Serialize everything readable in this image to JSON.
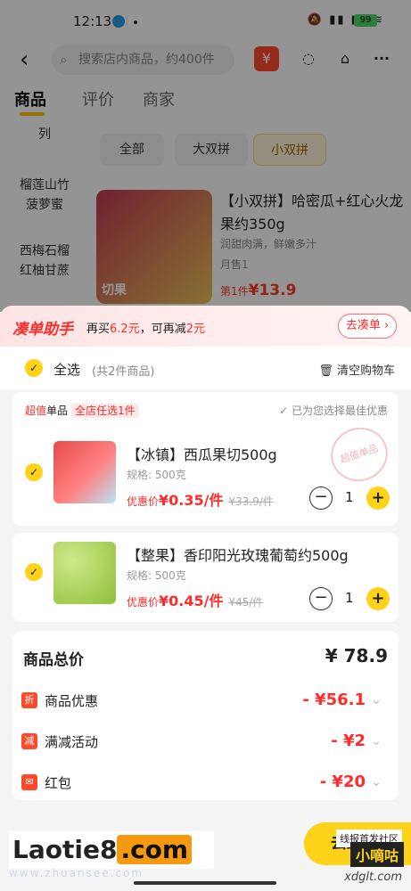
{
  "status": {
    "time": "12:13",
    "battery": "99"
  },
  "header": {
    "search_placeholder": "搜索店内商品，约400件"
  },
  "tabs": [
    {
      "label": "商品"
    },
    {
      "label": "评价"
    },
    {
      "label": "商家"
    }
  ],
  "sidebar": [
    "列",
    "榴莲山竹\n菠萝蜜",
    "西梅石榴\n红柚甘蔗"
  ],
  "filter_chips": [
    {
      "label": "全部"
    },
    {
      "label": "大双拼"
    },
    {
      "label": "小双拼"
    }
  ],
  "background_product": {
    "title": "【小双拼】哈密瓜+红心火龙果约350g",
    "subtitle": "润甜肉满，鲜嫩多汁",
    "sold": "月售1",
    "price_prefix": "第1件",
    "price": "¥13.9",
    "image_tag": "切果"
  },
  "cart": {
    "banner": {
      "logo": "凑单助手",
      "msg_prefix": "再买",
      "msg_amount": "6.2元",
      "msg_mid": "，可再减",
      "msg_discount": "2元",
      "go_label": "去凑单"
    },
    "select_all": "全选",
    "count": "(共2件商品)",
    "clear": "清空购物车",
    "promo": {
      "type1": "超值",
      "type2": "单品",
      "scope": "全店任选1件",
      "best": "已为您选择最佳优惠"
    },
    "items": [
      {
        "name": "【冰镇】西瓜果切500g",
        "spec": "规格: 500克",
        "price_label": "优惠价",
        "price": "¥0.35/件",
        "original": "¥33.9/件",
        "qty": "1",
        "stamp": "超值单品"
      },
      {
        "name": "【整果】香印阳光玫瑰葡萄约500g",
        "spec": "规格: 500克",
        "price_label": "优惠价",
        "price": "¥0.45/件",
        "original": "¥45/件",
        "qty": "1"
      }
    ],
    "summary": {
      "total_label": "商品总价",
      "total": "¥ 78.9",
      "rows": [
        {
          "icon": "折",
          "label": "商品优惠",
          "value": "- ¥56.1"
        },
        {
          "icon": "减",
          "label": "满减活动",
          "value": "- ¥2"
        },
        {
          "icon": "✉",
          "label": "红包",
          "value": "- ¥20"
        }
      ]
    }
  },
  "footer": {
    "checkout": "去结算",
    "watermark_main": "Laotie8",
    "watermark_com": ".com",
    "watermark_sub": "www.zhuansee.com",
    "watermark_right1": "线报首发社区",
    "watermark_right2": "小嘀咕",
    "watermark_right3": "xdglt.com"
  },
  "colors": {
    "accent": "#ffd21a",
    "price_red": "#ff2a2a"
  }
}
